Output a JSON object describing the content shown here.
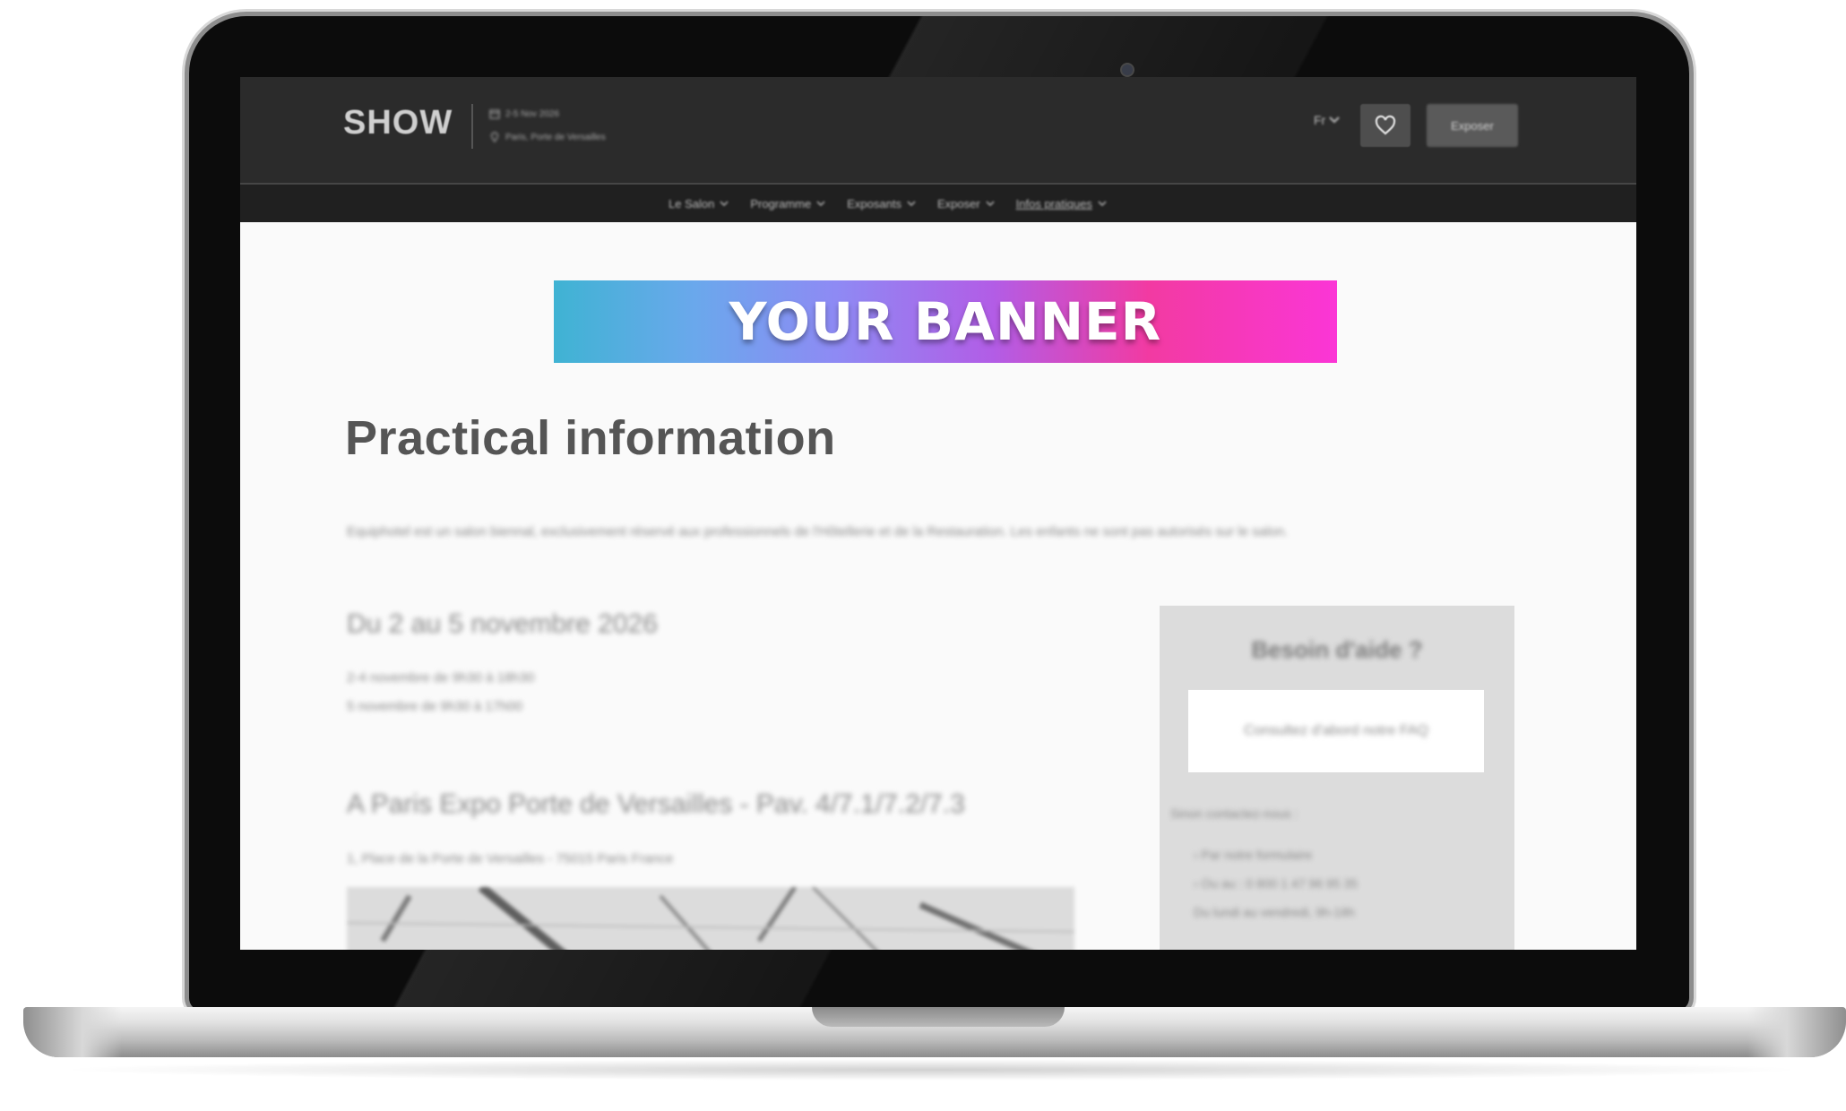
{
  "site": {
    "logo": "SHOW",
    "event_dates": "2-5 Nov 2026",
    "event_location": "Paris, Porte de Versailles",
    "language": "Fr",
    "exhibit_button": "Exposer"
  },
  "nav": {
    "items": [
      {
        "label": "Le Salon"
      },
      {
        "label": "Programme"
      },
      {
        "label": "Exposants"
      },
      {
        "label": "Exposer"
      },
      {
        "label": "Infos pratiques"
      }
    ]
  },
  "banner": {
    "text": "YOUR BANNER"
  },
  "page": {
    "title": "Practical information",
    "intro": "Equiphotel est un salon biennal, exclusivement réservé aux professionnels de l'Hôtellerie et de la Restauration. Les enfants ne sont pas autorisés sur le salon.",
    "dates_heading": "Du 2 au 5 novembre 2026",
    "hours": [
      "2-4 novembre de 9h30 à 18h30",
      "5 novembre de 9h30 à 17h00"
    ],
    "venue_heading": "A Paris Expo Porte de Versailles - Pav. 4/7.1/7.2/7.3",
    "venue_address": "1, Place de la Porte de Versailles - 75015 Paris France"
  },
  "help": {
    "title": "Besoin d'aide ?",
    "faq_text": "Consultez d'abord notre FAQ",
    "contact_label": "Sinon contactez-nous :",
    "contact_lines": [
      "› Par notre formulaire",
      "› Ou au : 0 800 1 47 96 95 35",
      "Du lundi au vendredi, 9h-18h"
    ]
  },
  "colors": {
    "header_bg": "#2b2b2b",
    "subnav_bg": "#202020",
    "banner_gradient_start": "#3fb3d3",
    "banner_gradient_end": "#fb36d6",
    "title_color": "#555555"
  }
}
